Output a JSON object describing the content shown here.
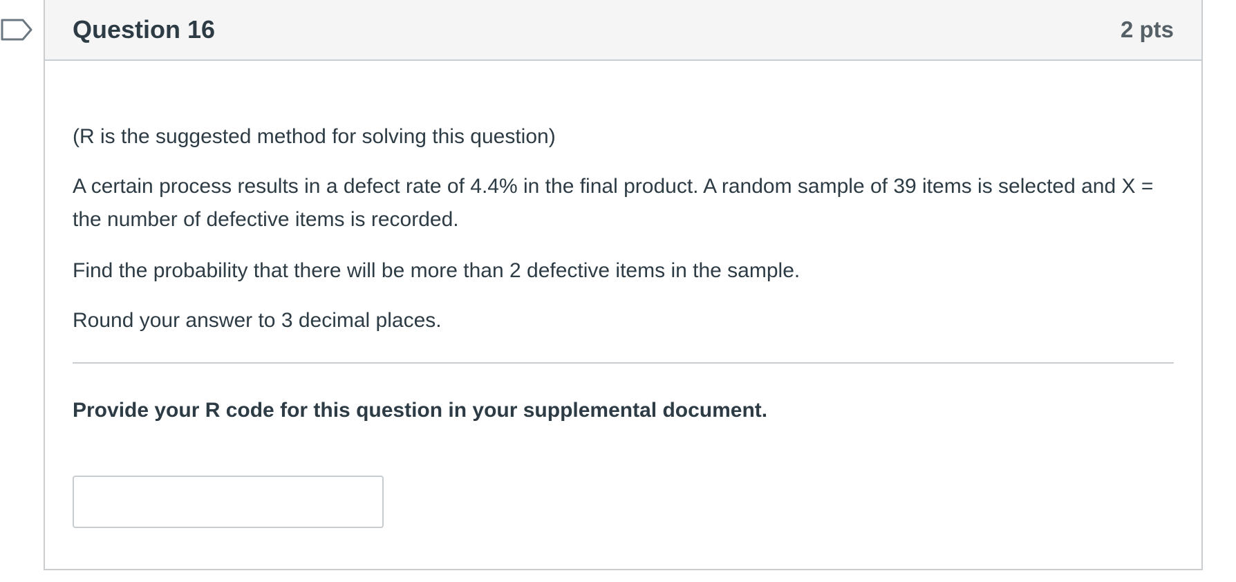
{
  "question": {
    "title": "Question 16",
    "points": "2 pts",
    "paragraphs": [
      "(R is the suggested method for solving this question)",
      "A certain process results in a defect rate of 4.4% in the final product. A random sample of 39 items is selected and X = the number of defective items is recorded.",
      "Find the probability that there will be more than 2 defective items in the sample.",
      "Round your answer to 3 decimal places."
    ],
    "instruction": "Provide your R code for this question in your supplemental document.",
    "answer": {
      "value": "",
      "placeholder": ""
    }
  },
  "icons": {
    "flag": "flag-question-icon"
  },
  "colors": {
    "text": "#2d3b45",
    "header_bg": "#f5f5f5",
    "border": "#c7cdd1",
    "flag_stroke": "#6b7780"
  }
}
